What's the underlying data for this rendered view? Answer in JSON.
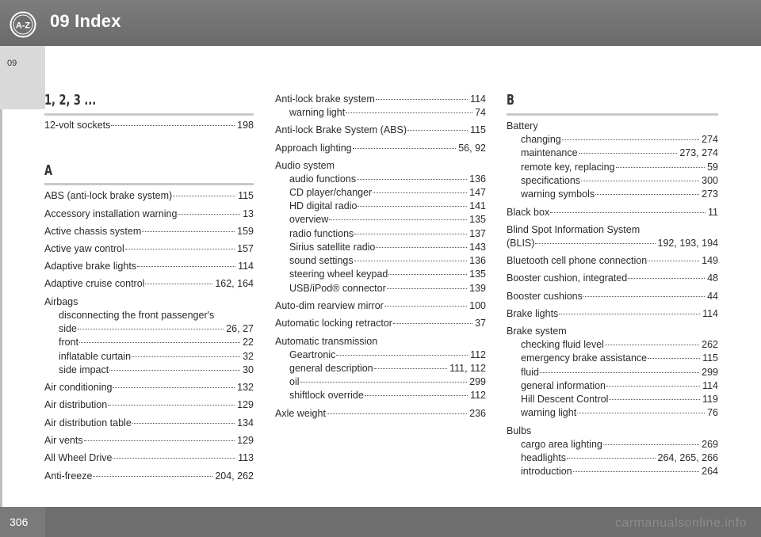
{
  "header": {
    "title": "09 Index",
    "icon_text": "A-Z"
  },
  "side_tab": {
    "chapter": "09"
  },
  "footer": {
    "page_number": "306",
    "watermark": "carmanualsonline.info"
  },
  "col1": {
    "sec1": "1, 2, 3 ...",
    "e_12volt": {
      "label": "12-volt sockets",
      "page": "198"
    },
    "secA": "A",
    "e_abs": {
      "label": "ABS (anti-lock brake system)",
      "page": "115"
    },
    "e_acc": {
      "label": "Accessory installation warning",
      "page": "13"
    },
    "e_acs": {
      "label": "Active chassis system",
      "page": "159"
    },
    "e_ayc": {
      "label": "Active yaw control",
      "page": "157"
    },
    "e_abl": {
      "label": "Adaptive brake lights",
      "page": "114"
    },
    "e_acc2": {
      "label": "Adaptive cruise control",
      "page": "162, 164"
    },
    "airbags": "Airbags",
    "airbags_disc": "disconnecting the front passenger's",
    "e_side1": {
      "label": "side",
      "page": "26, 27"
    },
    "e_front": {
      "label": "front",
      "page": "22"
    },
    "e_curtain": {
      "label": "inflatable curtain",
      "page": "32"
    },
    "e_sideimp": {
      "label": "side impact",
      "page": "30"
    },
    "e_aircon": {
      "label": "Air conditioning",
      "page": "132"
    },
    "e_airdist": {
      "label": "Air distribution",
      "page": "129"
    },
    "e_airdisttab": {
      "label": "Air distribution table",
      "page": "134"
    },
    "e_vents": {
      "label": "Air vents",
      "page": "129"
    },
    "e_awd": {
      "label": "All Wheel Drive",
      "page": "113"
    },
    "e_antifreeze": {
      "label": "Anti-freeze",
      "page": "204, 262"
    }
  },
  "col2": {
    "e_alb": {
      "label": "Anti-lock brake system",
      "page": "114"
    },
    "e_alb_warn": {
      "label": "warning light",
      "page": "74"
    },
    "e_abs2": {
      "label": "Anti-lock Brake System (ABS)",
      "page": "115"
    },
    "e_approach": {
      "label": "Approach lighting",
      "page": "56, 92"
    },
    "audio": "Audio system",
    "e_af": {
      "label": "audio functions",
      "page": "136"
    },
    "e_cd": {
      "label": "CD player/changer",
      "page": "147"
    },
    "e_hd": {
      "label": "HD digital radio",
      "page": "141"
    },
    "e_ov": {
      "label": "overview",
      "page": "135"
    },
    "e_rf": {
      "label": "radio functions",
      "page": "137"
    },
    "e_sir": {
      "label": "Sirius satellite radio",
      "page": "143"
    },
    "e_ss": {
      "label": "sound settings",
      "page": "136"
    },
    "e_swk": {
      "label": "steering wheel keypad",
      "page": "135"
    },
    "e_usb": {
      "label": "USB/iPod® connector",
      "page": "139"
    },
    "e_autodim": {
      "label": "Auto-dim rearview mirror",
      "page": "100"
    },
    "e_autolock": {
      "label": "Automatic locking retractor",
      "page": "37"
    },
    "auto_trans": "Automatic transmission",
    "e_gear": {
      "label": "Geartronic",
      "page": "112"
    },
    "e_gendesc": {
      "label": "general description",
      "page": "111, 112"
    },
    "e_oil": {
      "label": "oil",
      "page": "299"
    },
    "e_shift": {
      "label": "shiftlock override",
      "page": "112"
    },
    "e_axle": {
      "label": "Axle weight",
      "page": "236"
    }
  },
  "col3": {
    "secB": "B",
    "battery": "Battery",
    "e_charging": {
      "label": "changing",
      "page": "274"
    },
    "e_maint": {
      "label": "maintenance",
      "page": "273, 274"
    },
    "e_remote": {
      "label": "remote key, replacing",
      "page": "59"
    },
    "e_spec": {
      "label": "specifications",
      "page": "300"
    },
    "e_warnsym": {
      "label": "warning symbols",
      "page": "273"
    },
    "e_blackbox": {
      "label": "Black box",
      "page": "11"
    },
    "blis": "Blind Spot Information System",
    "e_blis": {
      "label": "(BLIS)",
      "page": "192, 193, 194"
    },
    "e_bt": {
      "label": "Bluetooth cell phone connection",
      "page": "149"
    },
    "e_booster1": {
      "label": "Booster cushion, integrated",
      "page": "48"
    },
    "e_booster2": {
      "label": "Booster cushions",
      "page": "44"
    },
    "e_brakelights": {
      "label": "Brake lights",
      "page": "114"
    },
    "brake_sys": "Brake system",
    "e_fluidlvl": {
      "label": "checking fluid level",
      "page": "262"
    },
    "e_emerg": {
      "label": "emergency brake assistance",
      "page": "115"
    },
    "e_fluid": {
      "label": "fluid",
      "page": "299"
    },
    "e_geninfo": {
      "label": "general information",
      "page": "114"
    },
    "e_hdc": {
      "label": "Hill Descent Control",
      "page": "119"
    },
    "e_warnlight": {
      "label": "warning light",
      "page": "76"
    },
    "bulbs": "Bulbs",
    "e_cargo": {
      "label": "cargo area lighting",
      "page": "269"
    },
    "e_headl": {
      "label": "headlights",
      "page": "264, 265, 266"
    },
    "e_intro": {
      "label": "introduction",
      "page": "264"
    }
  }
}
